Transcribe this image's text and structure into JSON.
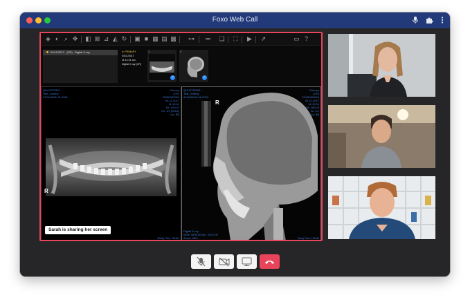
{
  "window": {
    "title": "Foxo Web Call",
    "accent_color": "#223a7a",
    "share_border_color": "#e8445a",
    "titlebar_icons": [
      "mic-icon",
      "extension-icon",
      "more-vert-icon"
    ]
  },
  "viewer": {
    "toolbar_icons": [
      "cube-icon",
      "contrast-icon",
      "zoom-icon",
      "pan-icon",
      "invert-icon",
      "crosshair-icon",
      "measure-icon",
      "flip-icon",
      "rotate-icon",
      "layout-1-icon",
      "layout-2-icon",
      "layout-3-icon",
      "layout-4-icon",
      "layout-grid-icon",
      "link-icon",
      "ruler-icon",
      "stack-icon",
      "fullscreen-icon",
      "play-icon",
      "share-icon",
      "document-icon",
      "help-icon"
    ],
    "study": {
      "date": "04/11/2017",
      "count": "(CR)",
      "description": "Digital X-ray"
    },
    "study_info": {
      "label": "PRIMARY",
      "date": "04/11/2017",
      "time": "11:12:21 am",
      "description": "Digital X-ray (CR)"
    },
    "thumbnails": [
      {
        "number": "1",
        "type": "panoramic"
      },
      {
        "number": "2",
        "type": "cephalometric"
      }
    ],
    "left_viewport": {
      "top_left": [
        "QHU2732303",
        "Test, Johnny",
        "01/01/M/01-01-2001"
      ],
      "top_right": [
        "Primary",
        "(CR)",
        "20180402004",
        "04-11-2017",
        "11:12:41",
        "Se: 1001/3",
        "Im: 1/1 [1/001]",
        "Lsc: [R]"
      ],
      "orientation_marker": "R",
      "bottom_right": "Study Part: HEAD"
    },
    "right_viewport": {
      "top_left": [
        "QHU2732303",
        "Test, Johnny",
        "01/01/M/01-01-2001"
      ],
      "top_right": [
        "Primary",
        "(CR)",
        "20180402004",
        "04-11-2017",
        "11:12:41",
        "Se: 1001/3",
        "Im: 1/1",
        "Lsc: [R]"
      ],
      "orientation_marker": "R",
      "bottom_left": [
        "Digital X-ray",
        "W/W: 4095.00 WC: 2047.00",
        "Zoom: 46%"
      ],
      "bottom_right": "Body Part: HEAD"
    },
    "sharing_message": "Sarah is sharing her screen"
  },
  "participants": [
    {
      "name": "participant-1",
      "icon": "video-feed"
    },
    {
      "name": "participant-2",
      "icon": "video-feed"
    },
    {
      "name": "participant-3",
      "icon": "video-feed"
    }
  ],
  "controls": {
    "mute": "mic-off-icon",
    "camera": "camera-off-icon",
    "screen_share": "monitor-icon",
    "end_call": "phone-hangup-icon"
  }
}
